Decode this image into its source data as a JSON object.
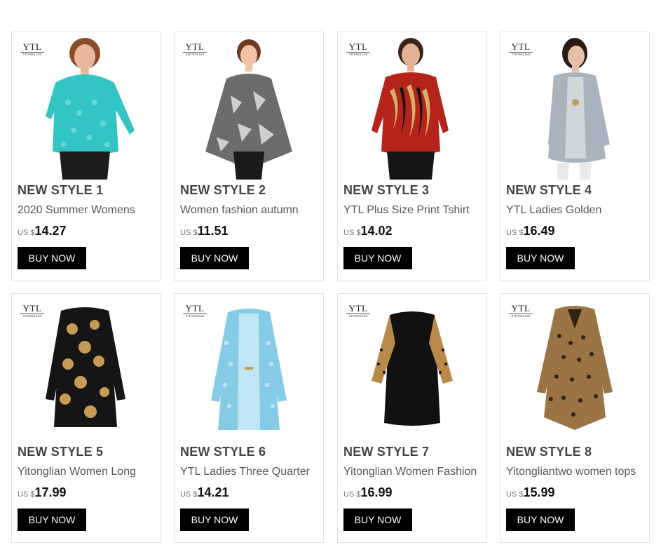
{
  "products": [
    {
      "brand": "YTL",
      "brand_sub": "YITONGLIAN",
      "title": "NEW STYLE 1",
      "desc": "2020 Summer Womens",
      "currency": "US $",
      "price": "14.27",
      "button": "BUY NOW",
      "colors": {
        "top": "#33c4c4",
        "pattern": "#7fe0dc",
        "skin": "#e9b89a",
        "hair": "#8a4b2a",
        "pants": "#1d1d1d"
      }
    },
    {
      "brand": "YTL",
      "brand_sub": "YITONGLIAN",
      "title": "NEW STYLE 2",
      "desc": "Women fashion autumn",
      "currency": "US $",
      "price": "11.51",
      "button": "BUY NOW",
      "colors": {
        "top": "#6c6c6c",
        "pattern": "#e8e8e8",
        "skin": "#efc3a4",
        "hair": "#6b3b24",
        "pants": "#1a1a1a"
      }
    },
    {
      "brand": "YTL",
      "brand_sub": "YITONGLIAN",
      "title": "NEW STYLE 3",
      "desc": "YTL Plus Size Print Tshirt",
      "currency": "US $",
      "price": "14.02",
      "button": "BUY NOW",
      "colors": {
        "top": "#b6231b",
        "pattern": "#d6b06a",
        "skin": "#e2b196",
        "hair": "#3a2418",
        "pants": "#151515"
      }
    },
    {
      "brand": "YTL",
      "brand_sub": "YITONGLIAN",
      "title": "NEW STYLE 4",
      "desc": "YTL Ladies Golden",
      "currency": "US $",
      "price": "16.49",
      "button": "BUY NOW",
      "colors": {
        "top": "#a9b3bd",
        "pattern": "#cfd6dc",
        "skin": "#e8c0a8",
        "hair": "#2a1a12",
        "pants": "#e9e9e9"
      }
    },
    {
      "brand": "YTL",
      "brand_sub": "YITONGLIAN",
      "title": "NEW STYLE 5",
      "desc": "Yitonglian Women Long",
      "currency": "US $",
      "price": "17.99",
      "button": "BUY NOW",
      "colors": {
        "top": "#151515",
        "pattern": "#c79a55",
        "skin": "",
        "hair": "",
        "pants": ""
      }
    },
    {
      "brand": "YTL",
      "brand_sub": "YITONGLIAN",
      "title": "NEW STYLE 6",
      "desc": "YTL Ladies Three Quarter",
      "currency": "US $",
      "price": "14.21",
      "button": "BUY NOW",
      "colors": {
        "top": "#86cbe6",
        "pattern": "#bfe6f4",
        "skin": "",
        "hair": "",
        "pants": ""
      }
    },
    {
      "brand": "YTL",
      "brand_sub": "YITONGLIAN",
      "title": "NEW STYLE 7",
      "desc": "Yitonglian Women Fashion",
      "currency": "US $",
      "price": "16.99",
      "button": "BUY NOW",
      "colors": {
        "top": "#111111",
        "pattern": "#b88a4a",
        "skin": "",
        "hair": "",
        "pants": ""
      }
    },
    {
      "brand": "YTL",
      "brand_sub": "YITONGLIAN",
      "title": "NEW STYLE 8",
      "desc": "Yitongliantwo women tops",
      "currency": "US $",
      "price": "15.99",
      "button": "BUY NOW",
      "colors": {
        "top": "#9a7445",
        "pattern": "#2e2215",
        "skin": "",
        "hair": "",
        "pants": ""
      }
    }
  ]
}
